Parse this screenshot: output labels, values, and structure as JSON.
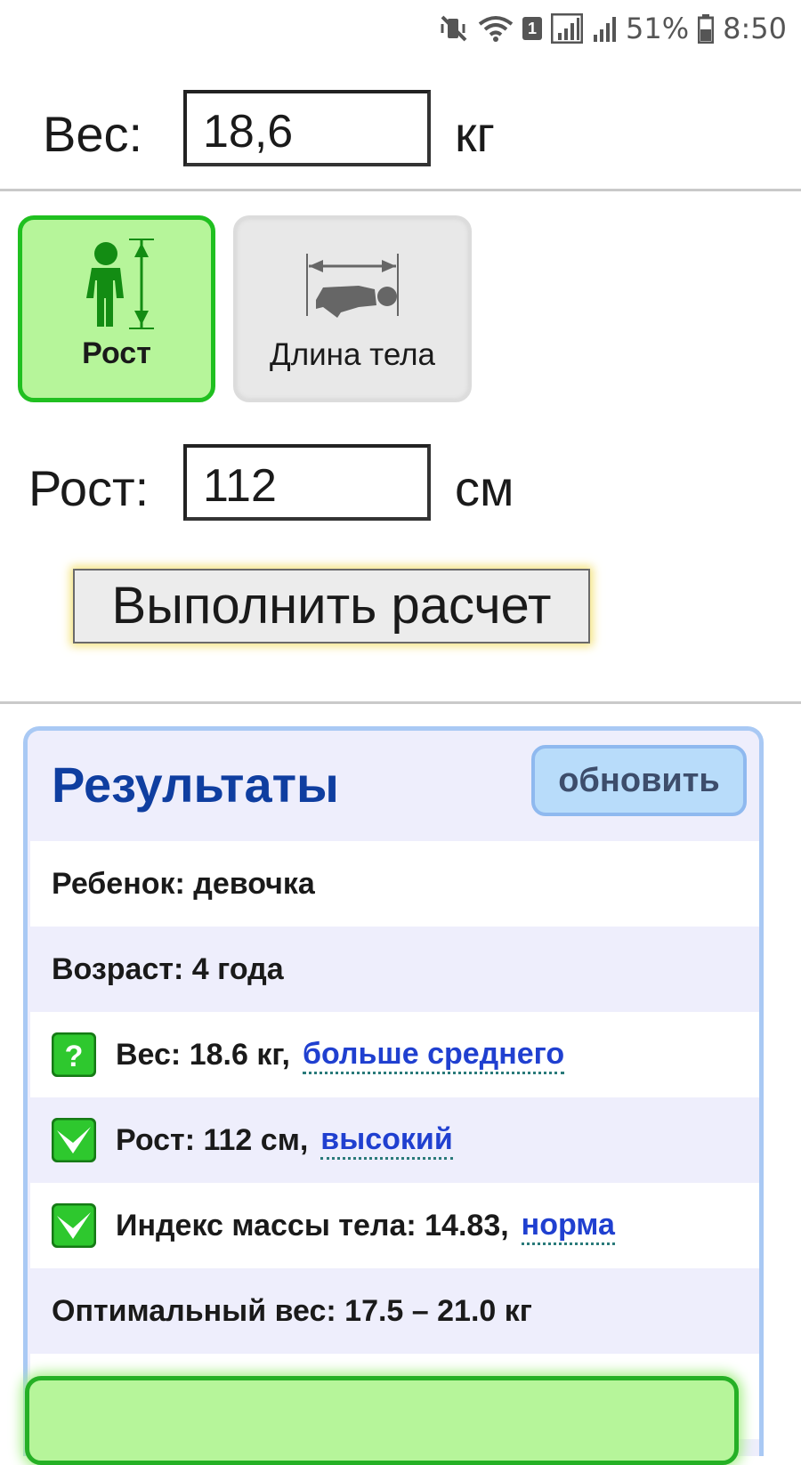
{
  "status_bar": {
    "sim": "1",
    "battery": "51%",
    "time": "8:50"
  },
  "weight": {
    "label": "Вес:",
    "value": "18,6",
    "unit": "кг"
  },
  "mode_toggle": {
    "height_label": "Рост",
    "length_label": "Длина тела",
    "selected": "Рост"
  },
  "height": {
    "label": "Рост:",
    "value": "112",
    "unit": "см"
  },
  "calc_button": "Выполнить расчет",
  "results": {
    "title": "Результаты",
    "refresh": "обновить",
    "child": "Ребенок: девочка",
    "age": "Возраст: 4 года",
    "weight_text": "Вес: 18.6 кг,",
    "weight_status": "больше среднего",
    "height_text": "Рост: 112 см,",
    "height_status": "высокий",
    "bmi_text": "Индекс массы тела: 14.83,",
    "bmi_status": "норма",
    "optimal": "Оптимальный вес: 17.5 – 21.0 кг"
  },
  "colors": {
    "accent_green": "#20c020",
    "title_blue": "#0f3ea0",
    "link_blue": "#2040d0"
  }
}
